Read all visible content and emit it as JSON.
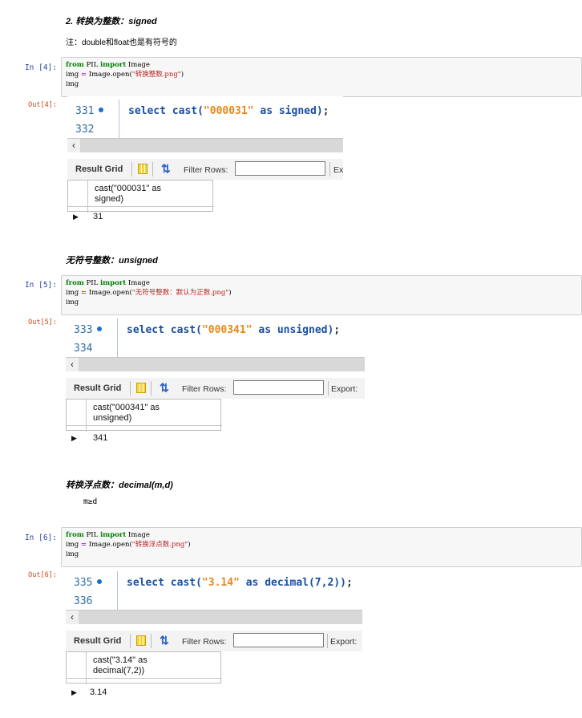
{
  "sections": [
    {
      "heading": "2. 转换为整数：signed",
      "note": "注：double和float也是有符号的",
      "in_prompt": "In  [4]:",
      "out_prompt": "Out[4]:",
      "code": {
        "l1_kw1": "from",
        "l1_mod": " PIL ",
        "l1_kw2": "import",
        "l1_name": " Image",
        "l2_pre": "img ",
        "l2_eq": "=",
        "l2_mid": " Image.open(",
        "l2_str": "\"转换整数.png\"",
        "l2_end": ")",
        "l3": "img"
      },
      "editor": {
        "line1": "331",
        "line2": "332",
        "sql_kw": "select cast(",
        "sql_str": "\"000031\"",
        "sql_tail": " as signed)",
        "sql_semi": ";"
      },
      "toolbar": {
        "result_grid": "Result Grid",
        "filter_rows": "Filter Rows:",
        "export": "Ex"
      },
      "result": {
        "header_line1": "cast(\"000031\" as",
        "header_line2": "signed)",
        "value": "31"
      }
    },
    {
      "heading": "无符号整数：unsigned",
      "in_prompt": "In  [5]:",
      "out_prompt": "Out[5]:",
      "code": {
        "l1_kw1": "from",
        "l1_mod": " PIL ",
        "l1_kw2": "import",
        "l1_name": " Image",
        "l2_pre": "img ",
        "l2_eq": "=",
        "l2_mid": " Image.open(",
        "l2_str": "\"无符号整数：默认为正数.png\"",
        "l2_end": ")",
        "l3": "img"
      },
      "editor": {
        "line1": "333",
        "line2": "334",
        "sql_kw": "select cast(",
        "sql_str": "\"000341\"",
        "sql_tail": " as unsigned)",
        "sql_semi": ";"
      },
      "toolbar": {
        "result_grid": "Result Grid",
        "filter_rows": "Filter Rows:",
        "export": "Export:"
      },
      "result": {
        "header_line1": "cast(\"000341\" as",
        "header_line2": "unsigned)",
        "value": "341"
      }
    },
    {
      "heading": "转换浮点数：decimal(m,d)",
      "note": "m≥d",
      "in_prompt": "In  [6]:",
      "out_prompt": "Out[6]:",
      "code": {
        "l1_kw1": "from",
        "l1_mod": " PIL ",
        "l1_kw2": "import",
        "l1_name": " Image",
        "l2_pre": "img ",
        "l2_eq": "=",
        "l2_mid": " Image.open(",
        "l2_str": "\"转换浮点数.png\"",
        "l2_end": ")",
        "l3": "img"
      },
      "editor": {
        "line1": "335",
        "line2": "336",
        "sql_kw": "select cast(",
        "sql_str": "\"3.14\"",
        "sql_tail": " as decimal(7,2))",
        "sql_semi": ";"
      },
      "toolbar": {
        "result_grid": "Result Grid",
        "filter_rows": "Filter Rows:",
        "export": "Export:"
      },
      "result": {
        "header_line1": "cast(\"3.14\" as",
        "header_line2": "decimal(7,2))",
        "value": "3.14"
      }
    }
  ],
  "colors": {
    "prompt_in": "#303f9f",
    "prompt_out": "#d84315",
    "sql_keyword": "#1a4fa0",
    "sql_string": "#e8861a",
    "line_number": "#2f6ea3"
  },
  "icons": [
    "grid-icon",
    "refresh-icon",
    "scroll-left-arrow-icon",
    "row-pointer-icon"
  ]
}
